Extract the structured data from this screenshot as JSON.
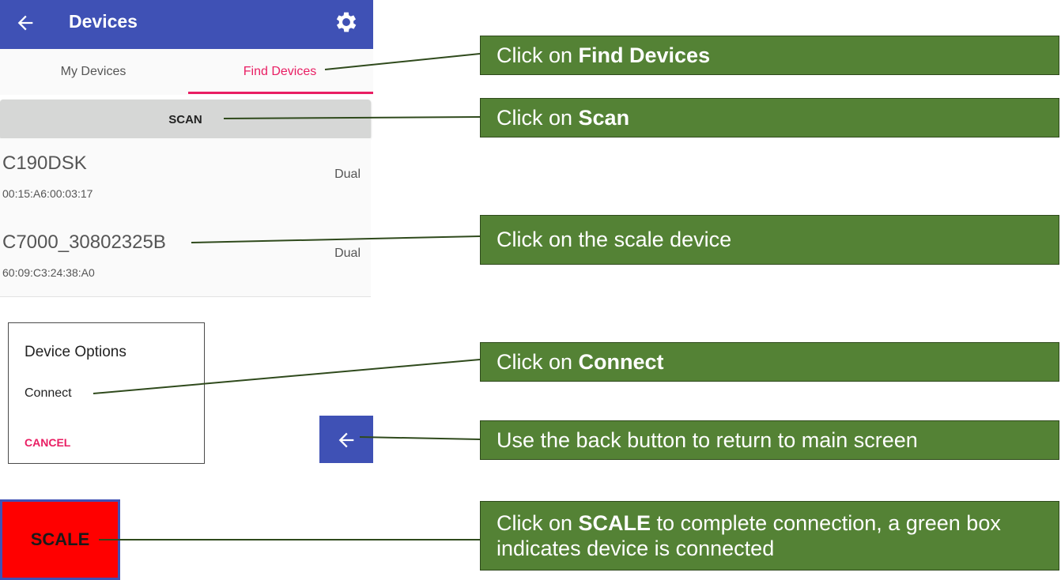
{
  "app": {
    "title": "Devices",
    "icons": {
      "back": "arrow-left-icon",
      "settings": "gear-icon"
    },
    "tabs": [
      {
        "label": "My Devices",
        "active": false
      },
      {
        "label": "Find Devices",
        "active": true
      }
    ],
    "scan_label": "SCAN",
    "devices": [
      {
        "name": "C190DSK",
        "mac": "00:15:A6:00:03:17",
        "type": "Dual"
      },
      {
        "name": "C7000_30802325B",
        "mac": "60:09:C3:24:38:A0",
        "type": "Dual"
      }
    ]
  },
  "dialog": {
    "title": "Device Options",
    "connect_label": "Connect",
    "cancel_label": "CANCEL"
  },
  "scale_button": {
    "label": "SCALE"
  },
  "callouts": {
    "find_devices": {
      "prefix": "Click on ",
      "bold": "Find Devices",
      "suffix": ""
    },
    "scan": {
      "prefix": "Click on ",
      "bold": "Scan",
      "suffix": ""
    },
    "scale_device": {
      "text": "Click on the scale device"
    },
    "connect": {
      "prefix": "Click on ",
      "bold": "Connect",
      "suffix": ""
    },
    "back": {
      "text": "Use the back button to return to main screen"
    },
    "scale": {
      "prefix": "Click on ",
      "bold": "SCALE",
      "suffix": " to complete connection, a green box indicates device is connected"
    }
  },
  "colors": {
    "appbar": "#3f51b5",
    "accent": "#e91e63",
    "callout_bg": "#548235",
    "scale_button": "#ff0000",
    "leader_line": "#2f4a1c"
  }
}
